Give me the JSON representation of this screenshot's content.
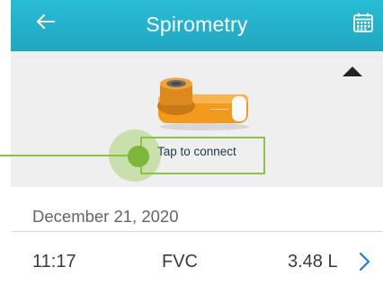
{
  "header": {
    "title": "Spirometry",
    "back_icon": "arrow-left-icon",
    "calendar_icon": "calendar-icon",
    "color": "#22aac4"
  },
  "device_panel": {
    "connect_label": "Tap to connect",
    "device_image": "spirometer-device",
    "collapse_icon": "triangle-up-icon",
    "highlight_color": "#8cc43e"
  },
  "history": {
    "date": "December 21, 2020",
    "entries": [
      {
        "time": "11:17",
        "type": "FVC",
        "value": "3.48 L",
        "chevron_icon": "chevron-right-icon"
      }
    ]
  }
}
